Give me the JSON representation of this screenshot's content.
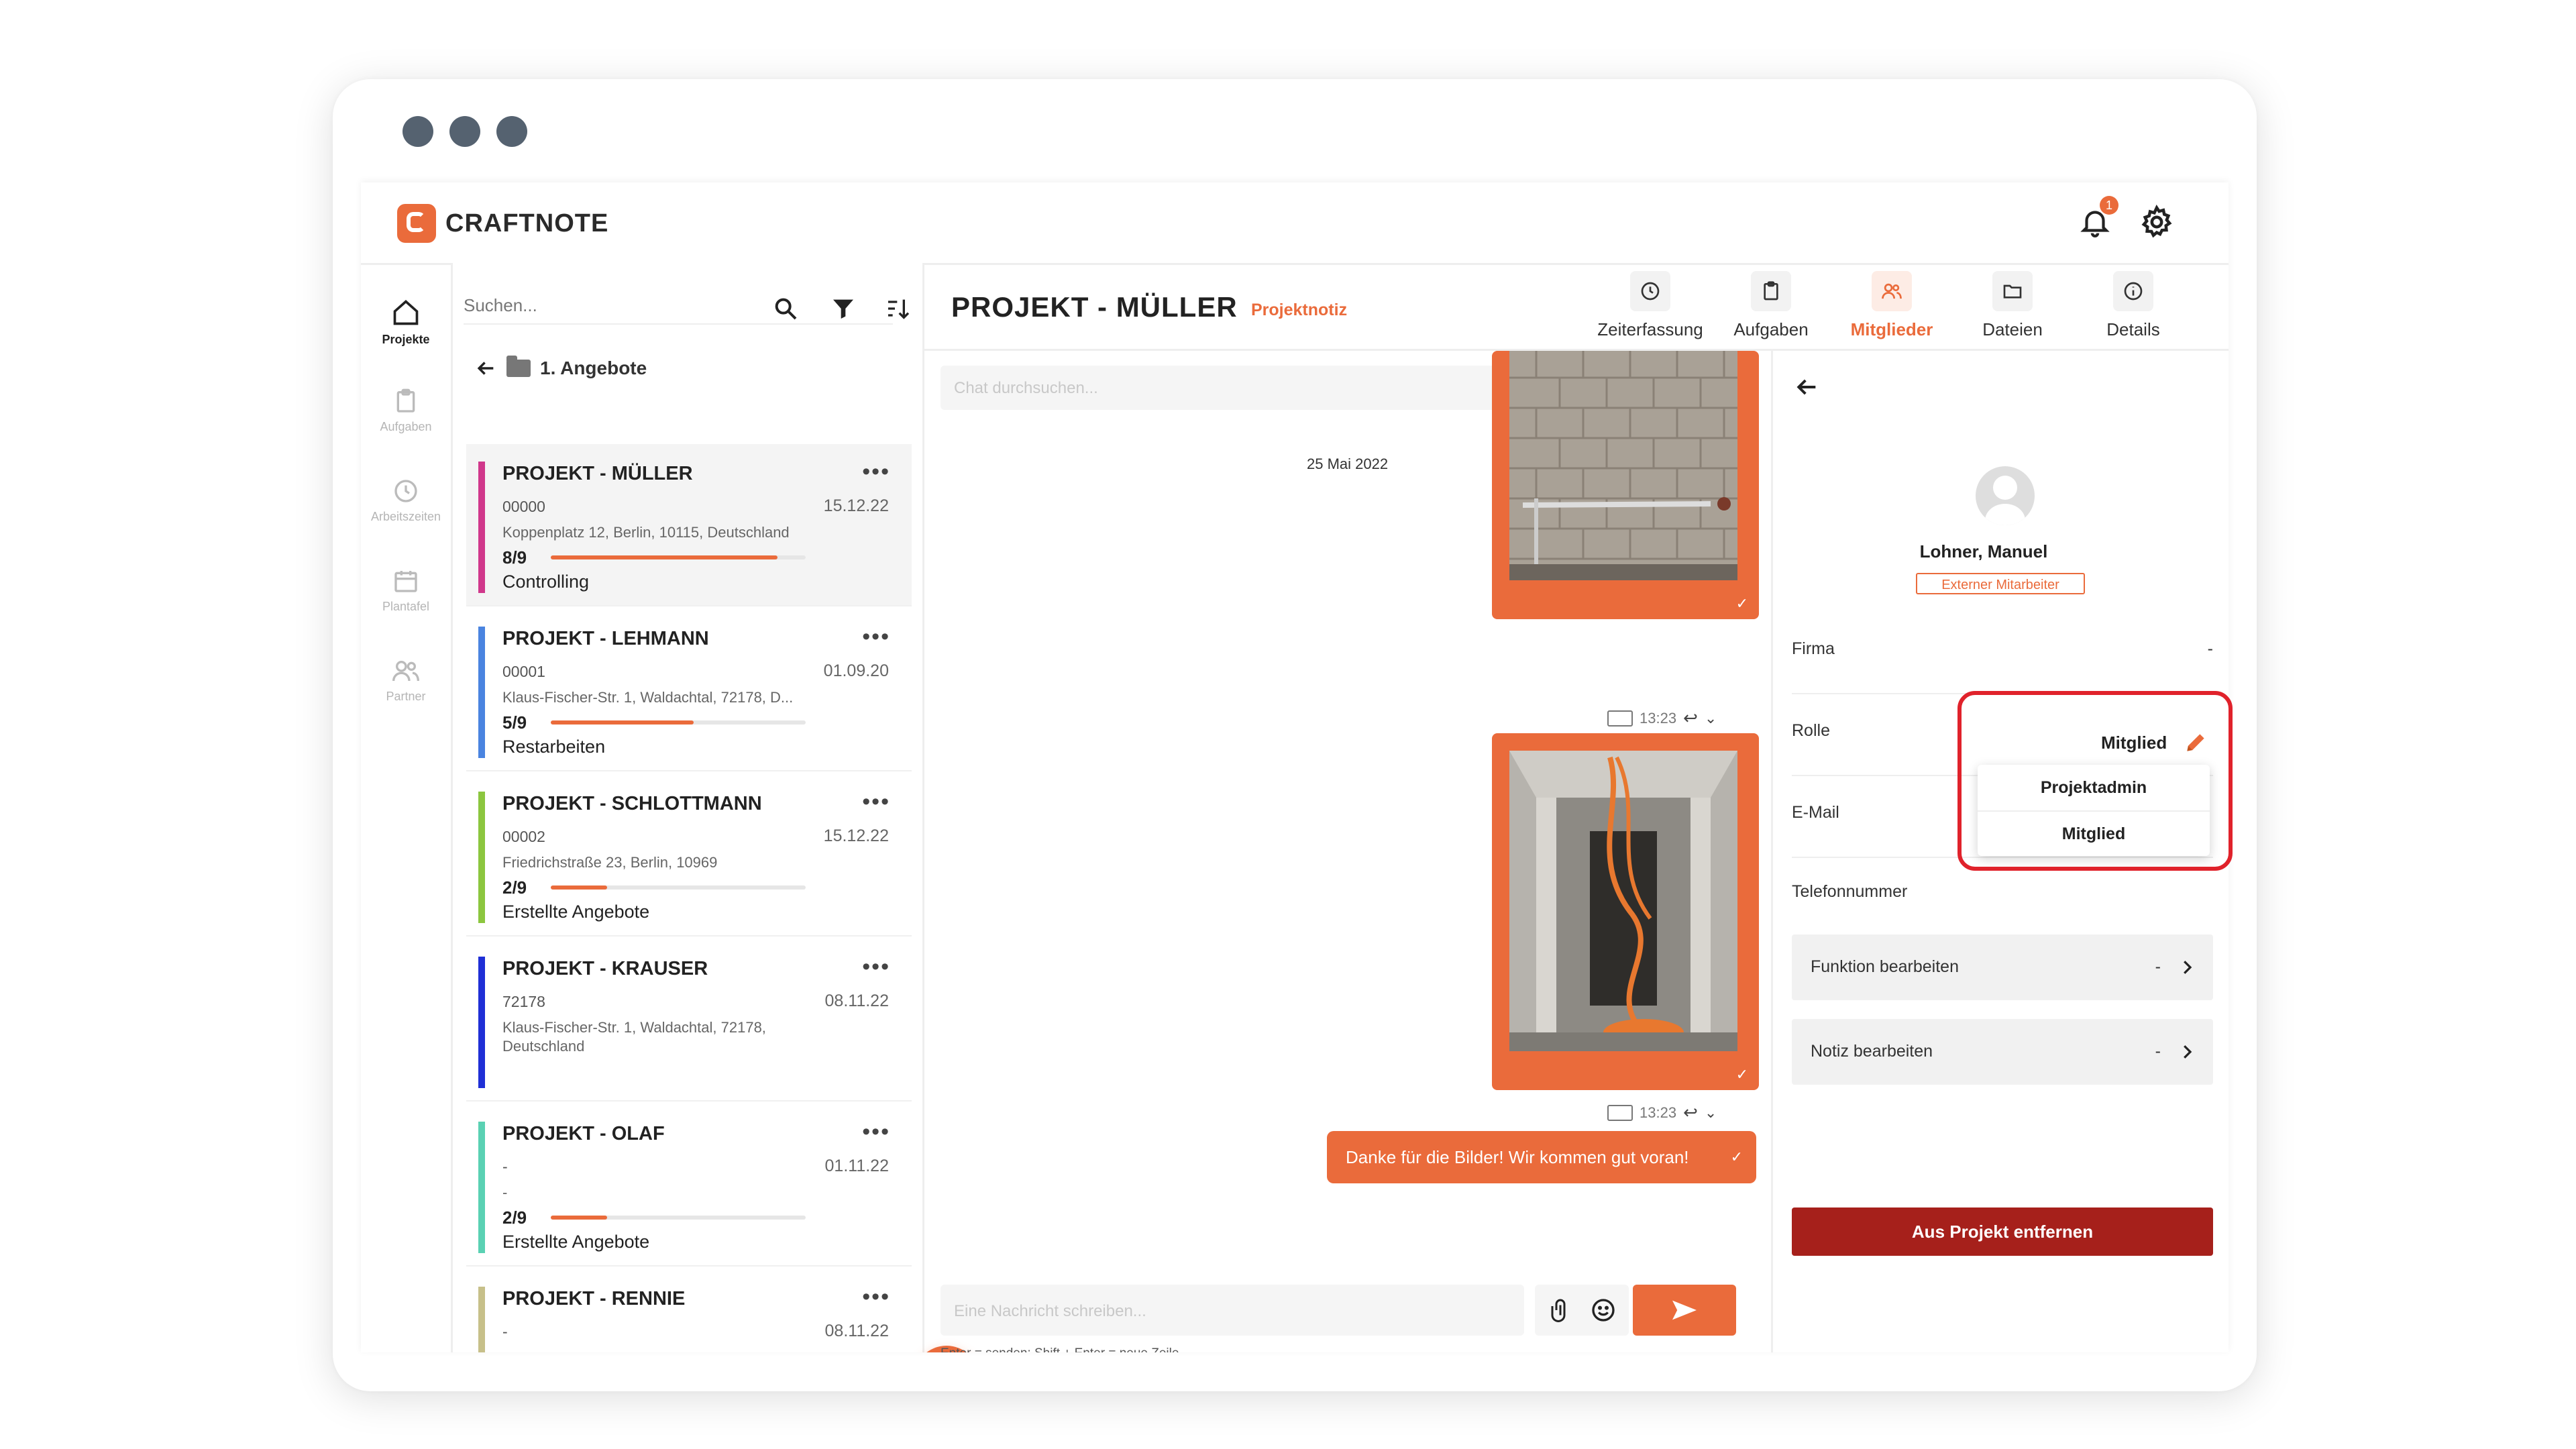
{
  "app": {
    "logo_text": "CRAFTNOTE",
    "notification_count": "1"
  },
  "nav": [
    {
      "label": "Projekte",
      "icon": "home-icon"
    },
    {
      "label": "Aufgaben",
      "icon": "clipboard-icon"
    },
    {
      "label": "Arbeitszeiten",
      "icon": "clock-icon"
    },
    {
      "label": "Plantafel",
      "icon": "calendar-icon"
    },
    {
      "label": "Partner",
      "icon": "users-icon"
    }
  ],
  "list": {
    "search_placeholder": "Suchen...",
    "breadcrumb": "1. Angebote",
    "projects": [
      {
        "title": "PROJEKT - MÜLLER",
        "number": "00000",
        "date": "15.12.22",
        "address": "Koppenplatz 12, Berlin, 10115, Deutschland",
        "progress": "8/9",
        "status": "Controlling",
        "color": "#d0378b",
        "fraction": 0.89
      },
      {
        "title": "PROJEKT - LEHMANN",
        "number": "00001",
        "date": "01.09.20",
        "address": "Klaus-Fischer-Str. 1, Waldachtal, 72178, D...",
        "progress": "5/9",
        "status": "Restarbeiten",
        "color": "#4a84e0",
        "fraction": 0.56
      },
      {
        "title": "PROJEKT - SCHLOTTMANN",
        "number": "00002",
        "date": "15.12.22",
        "address": "Friedrichstraße 23, Berlin, 10969",
        "progress": "2/9",
        "status": "Erstellte Angebote",
        "color": "#8cc63f",
        "fraction": 0.22
      },
      {
        "title": "PROJEKT - KRAUSER",
        "number": "72178",
        "date": "08.11.22",
        "address": "Klaus-Fischer-Str. 1, Waldachtal, 72178, Deutschland",
        "progress": "",
        "status": "",
        "color": "#1f2fd6",
        "fraction": 0
      },
      {
        "title": "PROJEKT - OLAF",
        "number": "-",
        "date": "01.11.22",
        "address": "-",
        "progress": "2/9",
        "status": "Erstellte Angebote",
        "color": "#5ad1b3",
        "fraction": 0.22
      },
      {
        "title": "PROJEKT - RENNIE",
        "number": "-",
        "date": "08.11.22",
        "address": "",
        "progress": "",
        "status": "",
        "color": "#c7c08a",
        "fraction": 0
      }
    ],
    "fab_label": "+"
  },
  "header": {
    "title": "PROJEKT - MÜLLER",
    "note_label": "Projektnotiz",
    "tabs": [
      {
        "label": "Zeiterfassung",
        "icon": "clock-icon"
      },
      {
        "label": "Aufgaben",
        "icon": "clipboard-icon"
      },
      {
        "label": "Mitglieder",
        "icon": "members-icon"
      },
      {
        "label": "Dateien",
        "icon": "folder-icon"
      },
      {
        "label": "Details",
        "icon": "info-icon"
      }
    ]
  },
  "chat": {
    "search_placeholder": "Chat durchsuchen...",
    "date": "25 Mai 2022",
    "time1": "13:23",
    "time2": "13:23",
    "message": "Danke für die Bilder! Wir kommen gut voran!",
    "composer_placeholder": "Eine Nachricht schreiben...",
    "hint": "Enter = senden; Shift + Enter = neue Zeile",
    "accent": "#ea6b3b"
  },
  "member": {
    "name": "Lohner, Manuel",
    "badge": "Externer Mitarbeiter",
    "fields": {
      "firma_label": "Firma",
      "firma_value": "-",
      "rolle_label": "Rolle",
      "rolle_value": "Mitglied",
      "email_label": "E-Mail",
      "telefon_label": "Telefonnummer"
    },
    "role_options": [
      "Projektadmin",
      "Mitglied"
    ],
    "funktion_label": "Funktion bearbeiten",
    "funktion_value": "-",
    "notiz_label": "Notiz bearbeiten",
    "notiz_value": "-",
    "remove_label": "Aus Projekt entfernen"
  }
}
